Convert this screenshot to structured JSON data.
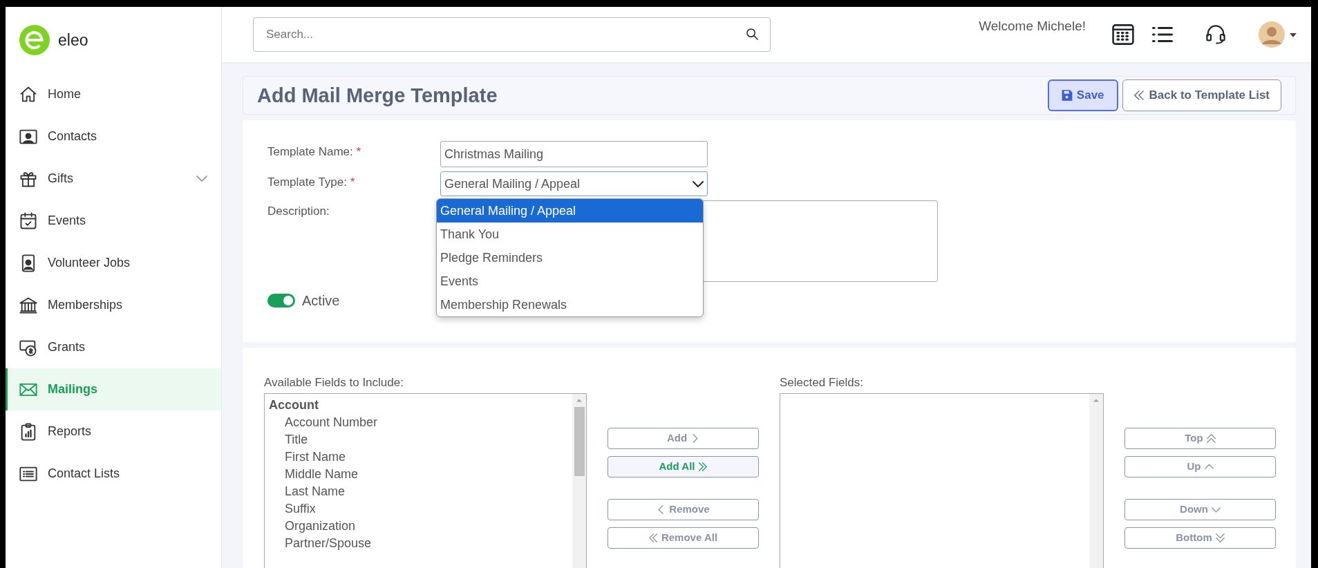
{
  "brand": {
    "name": "eleo"
  },
  "sidebar": {
    "items": [
      {
        "label": "Home",
        "selected": false,
        "expandable": false
      },
      {
        "label": "Contacts",
        "selected": false,
        "expandable": false
      },
      {
        "label": "Gifts",
        "selected": false,
        "expandable": true
      },
      {
        "label": "Events",
        "selected": false,
        "expandable": false
      },
      {
        "label": "Volunteer Jobs",
        "selected": false,
        "expandable": false
      },
      {
        "label": "Memberships",
        "selected": false,
        "expandable": false
      },
      {
        "label": "Grants",
        "selected": false,
        "expandable": false
      },
      {
        "label": "Mailings",
        "selected": true,
        "expandable": false
      },
      {
        "label": "Reports",
        "selected": false,
        "expandable": false
      },
      {
        "label": "Contact Lists",
        "selected": false,
        "expandable": false
      }
    ]
  },
  "header": {
    "search": {
      "placeholder": "Search..."
    },
    "welcome": "Welcome Michele!"
  },
  "page": {
    "title": "Add Mail Merge Template",
    "buttons": [
      {
        "label": "Save",
        "kind": "primary"
      },
      {
        "label": "Back to Template List",
        "kind": "back"
      }
    ]
  },
  "form": {
    "name": {
      "label": "Template Name:",
      "required_mark": "*",
      "value": "Christmas Mailing"
    },
    "type": {
      "label": "Template Type:",
      "required_mark": "*",
      "value": "General Mailing / Appeal",
      "expanded": true,
      "options": [
        {
          "label": "General Mailing / Appeal",
          "selected": true
        },
        {
          "label": "Thank You",
          "selected": false
        },
        {
          "label": "Pledge Reminders",
          "selected": false
        },
        {
          "label": "Events",
          "selected": false
        },
        {
          "label": "Membership Renewals",
          "selected": false
        }
      ]
    },
    "description": {
      "label": "Description:"
    },
    "active": {
      "label": "Active",
      "on": true
    }
  },
  "fields": {
    "available_label": "Available Fields to Include:",
    "selected_label": "Selected Fields:",
    "available": [
      {
        "label": "Account",
        "kind": "group"
      },
      {
        "label": "Account Number",
        "kind": "field"
      },
      {
        "label": "Title",
        "kind": "field"
      },
      {
        "label": "First Name",
        "kind": "field"
      },
      {
        "label": "Middle Name",
        "kind": "field"
      },
      {
        "label": "Last Name",
        "kind": "field"
      },
      {
        "label": "Suffix",
        "kind": "field"
      },
      {
        "label": "Organization",
        "kind": "field"
      },
      {
        "label": "Partner/Spouse",
        "kind": "field"
      }
    ],
    "move_buttons": [
      {
        "label": "Add",
        "kind": "right",
        "enabled": false
      },
      {
        "label": "Add All",
        "kind": "right-double",
        "enabled": true
      },
      {
        "label": "Remove",
        "kind": "left",
        "enabled": false
      },
      {
        "label": "Remove All",
        "kind": "left-double",
        "enabled": false
      }
    ],
    "order_buttons": [
      {
        "label": "Top",
        "kind": "up-double",
        "enabled": false
      },
      {
        "label": "Up",
        "kind": "up",
        "enabled": false
      },
      {
        "label": "Down",
        "kind": "down",
        "enabled": false
      },
      {
        "label": "Bottom",
        "kind": "down-double",
        "enabled": false
      }
    ]
  }
}
